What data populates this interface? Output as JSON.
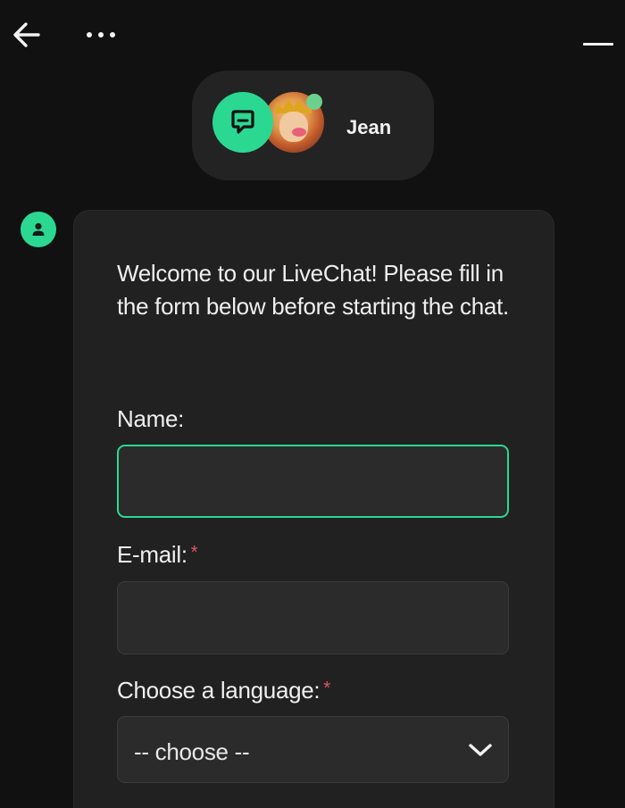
{
  "header": {
    "agent_name": "Jean"
  },
  "form": {
    "welcome_text": "Welcome to our LiveChat! Please fill in the form below before starting the chat.",
    "name_label": "Name:",
    "name_value": "",
    "email_label": "E-mail:",
    "email_value": "",
    "language_label": "Choose a language:",
    "language_selected": "-- choose --",
    "required_marker": "*"
  },
  "colors": {
    "background": "#111111",
    "card": "#212121",
    "accent": "#2bd892",
    "required": "#e0575f",
    "status_online": "#6bcf8e"
  },
  "icons": {
    "back": "back-arrow-icon",
    "more": "more-dots-icon",
    "minimize": "minimize-icon",
    "chat_logo": "chat-bubble-icon",
    "bot": "user-icon",
    "select": "chevron-down-icon"
  }
}
